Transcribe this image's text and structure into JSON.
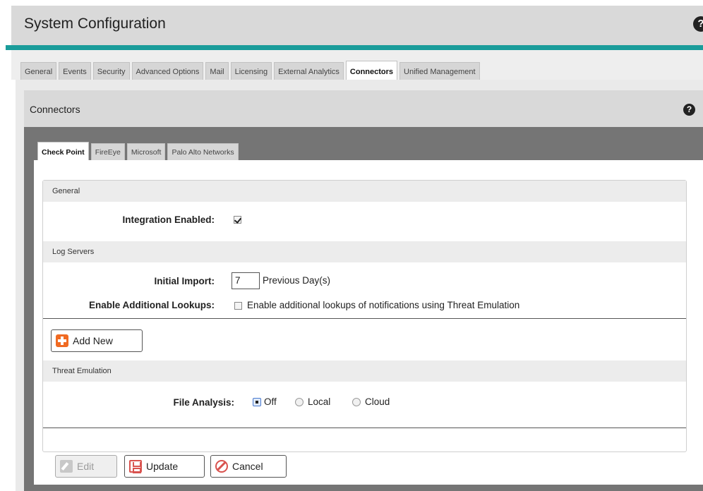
{
  "header": {
    "title": "System Configuration",
    "help_icon": "?"
  },
  "main_tabs": [
    {
      "label": "General",
      "active": false
    },
    {
      "label": "Events",
      "active": false
    },
    {
      "label": "Security",
      "active": false
    },
    {
      "label": "Advanced Options",
      "active": false
    },
    {
      "label": "Mail",
      "active": false
    },
    {
      "label": "Licensing",
      "active": false
    },
    {
      "label": "External Analytics",
      "active": false
    },
    {
      "label": "Connectors",
      "active": true
    },
    {
      "label": "Unified Management",
      "active": false
    }
  ],
  "panel": {
    "title": "Connectors",
    "help_icon": "?"
  },
  "connector_tabs": [
    {
      "label": "Check Point",
      "active": true
    },
    {
      "label": "FireEye",
      "active": false
    },
    {
      "label": "Microsoft",
      "active": false
    },
    {
      "label": "Palo Alto Networks",
      "active": false
    }
  ],
  "sections": {
    "general": "General",
    "log_servers": "Log Servers",
    "threat_emulation": "Threat Emulation"
  },
  "fields": {
    "integration_enabled": {
      "label": "Integration Enabled:",
      "checked": true
    },
    "initial_import": {
      "label": "Initial Import:",
      "value": "7",
      "suffix": "Previous Day(s)"
    },
    "additional_lookups": {
      "label": "Enable Additional Lookups:",
      "checked": false,
      "text": "Enable additional lookups of notifications using Threat Emulation"
    },
    "file_analysis": {
      "label": "File Analysis:",
      "selected": "Off",
      "options": [
        "Off",
        "Local",
        "Cloud"
      ]
    }
  },
  "buttons": {
    "add_new": "Add New",
    "edit": "Edit",
    "update": "Update",
    "cancel": "Cancel"
  },
  "colors": {
    "accent_teal": "#1a9c9a",
    "danger": "#d9534f",
    "add_orange": "#f06a22"
  }
}
